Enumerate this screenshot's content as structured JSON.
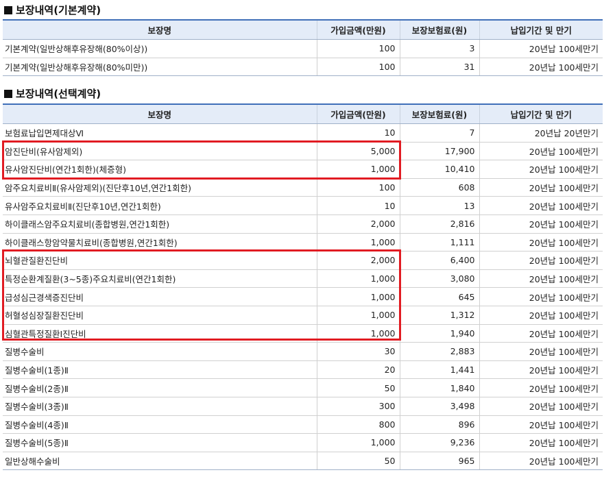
{
  "basic": {
    "title": "보장내역(기본계약)",
    "headers": [
      "보장명",
      "가입금액(만원)",
      "보장보험료(원)",
      "납입기간 및 만기"
    ],
    "rows": [
      {
        "name": "기본계약(일반상해후유장해(80%이상))",
        "amount": "100",
        "premium": "3",
        "term": "20년납 100세만기"
      },
      {
        "name": "기본계약(일반상해후유장해(80%미만))",
        "amount": "100",
        "premium": "31",
        "term": "20년납 100세만기"
      }
    ]
  },
  "optional": {
    "title": "보장내역(선택계약)",
    "headers": [
      "보장명",
      "가입금액(만원)",
      "보장보험료(원)",
      "납입기간 및 만기"
    ],
    "rows": [
      {
        "name": "보험료납입면제대상Ⅵ",
        "amount": "10",
        "premium": "7",
        "term": "20년납 20년만기"
      },
      {
        "name": "암진단비(유사암제외)",
        "amount": "5,000",
        "premium": "17,900",
        "term": "20년납 100세만기"
      },
      {
        "name": "유사암진단비(연간1회한)(체증형)",
        "amount": "1,000",
        "premium": "10,410",
        "term": "20년납 100세만기"
      },
      {
        "name": "암주요치료비Ⅱ(유사암제외)(진단후10년,연간1회한)",
        "amount": "100",
        "premium": "608",
        "term": "20년납 100세만기"
      },
      {
        "name": "유사암주요치료비Ⅱ(진단후10년,연간1회한)",
        "amount": "10",
        "premium": "13",
        "term": "20년납 100세만기"
      },
      {
        "name": "하이클래스암주요치료비(종합병원,연간1회한)",
        "amount": "2,000",
        "premium": "2,816",
        "term": "20년납 100세만기"
      },
      {
        "name": "하이클래스항암약물치료비(종합병원,연간1회한)",
        "amount": "1,000",
        "premium": "1,111",
        "term": "20년납 100세만기"
      },
      {
        "name": "뇌혈관질환진단비",
        "amount": "2,000",
        "premium": "6,400",
        "term": "20년납 100세만기"
      },
      {
        "name": "특정순환계질환(3~5종)주요치료비(연간1회한)",
        "amount": "1,000",
        "premium": "3,080",
        "term": "20년납 100세만기"
      },
      {
        "name": "급성심근경색증진단비",
        "amount": "1,000",
        "premium": "645",
        "term": "20년납 100세만기"
      },
      {
        "name": "허혈성심장질환진단비",
        "amount": "1,000",
        "premium": "1,312",
        "term": "20년납 100세만기"
      },
      {
        "name": "심혈관특정질환Ⅰ진단비",
        "amount": "1,000",
        "premium": "1,940",
        "term": "20년납 100세만기"
      },
      {
        "name": "질병수술비",
        "amount": "30",
        "premium": "2,883",
        "term": "20년납 100세만기"
      },
      {
        "name": "질병수술비(1종)Ⅱ",
        "amount": "20",
        "premium": "1,441",
        "term": "20년납 100세만기"
      },
      {
        "name": "질병수술비(2종)Ⅱ",
        "amount": "50",
        "premium": "1,840",
        "term": "20년납 100세만기"
      },
      {
        "name": "질병수술비(3종)Ⅱ",
        "amount": "300",
        "premium": "3,498",
        "term": "20년납 100세만기"
      },
      {
        "name": "질병수술비(4종)Ⅱ",
        "amount": "800",
        "premium": "896",
        "term": "20년납 100세만기"
      },
      {
        "name": "질병수술비(5종)Ⅱ",
        "amount": "1,000",
        "premium": "9,236",
        "term": "20년납 100세만기"
      },
      {
        "name": "일반상해수술비",
        "amount": "50",
        "premium": "965",
        "term": "20년납 100세만기"
      }
    ]
  },
  "highlight_color": "#e11b22",
  "header_accent": "#3f6fb8"
}
